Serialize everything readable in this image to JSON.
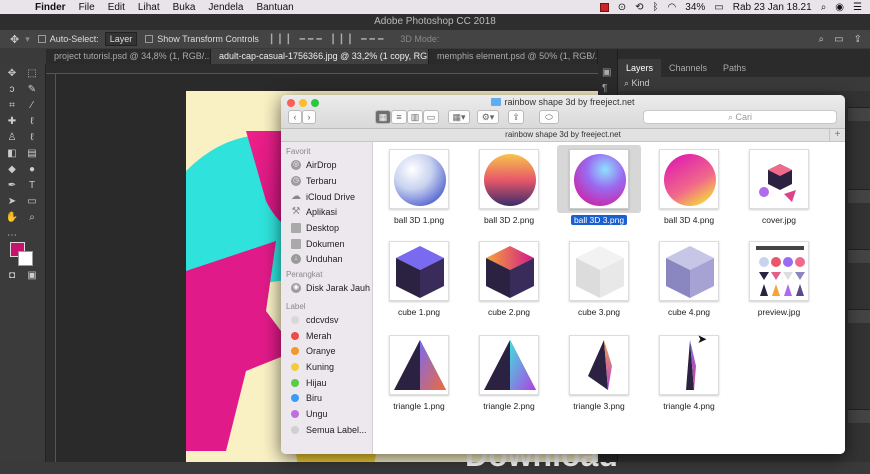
{
  "menubar": {
    "app": "Finder",
    "items": [
      "File",
      "Edit",
      "Lihat",
      "Buka",
      "Jendela",
      "Bantuan"
    ],
    "battery": "34%",
    "datetime": "Rab 23 Jan  18.21"
  },
  "photoshop": {
    "title": "Adobe Photoshop CC 2018",
    "auto_select_label": "Auto-Select:",
    "auto_select_value": "Layer",
    "transform_label": "Show Transform Controls",
    "mode_3d": "3D Mode:",
    "doc_tabs": [
      "project tutorisl.psd @ 34,8% (1, RGB/...",
      "adult-cap-casual-1756366.jpg @ 33,2% (1 copy, RGB/8) *",
      "memphis element.psd @ 50% (1, RGB/..."
    ],
    "canvas_text": "Download"
  },
  "layers_panel": {
    "tabs": [
      "Layers",
      "Channels",
      "Paths"
    ],
    "kind_label": "Kind"
  },
  "finder": {
    "title": "rainbow shape 3d by freeject.net",
    "path_title": "rainbow shape 3d by freeject.net",
    "search_placeholder": "Cari",
    "sidebar": {
      "favorites_header": "Favorit",
      "favorites": [
        "AirDrop",
        "Terbaru",
        "iCloud Drive",
        "Aplikasi",
        "Desktop",
        "Dokumen",
        "Unduhan"
      ],
      "devices_header": "Perangkat",
      "devices": [
        "Disk Jarak Jauh"
      ],
      "labels_header": "Label",
      "labels": [
        {
          "name": "cdcvdsv",
          "color": "#d8d8d8"
        },
        {
          "name": "Merah",
          "color": "#ee4b47"
        },
        {
          "name": "Oranye",
          "color": "#f5982b"
        },
        {
          "name": "Kuning",
          "color": "#f5cb3a"
        },
        {
          "name": "Hijau",
          "color": "#5cca47"
        },
        {
          "name": "Biru",
          "color": "#3b9cf5"
        },
        {
          "name": "Ungu",
          "color": "#bd6fe0"
        },
        {
          "name": "Semua Label...",
          "color": "#d0d0d0"
        }
      ]
    },
    "files": [
      "ball 3D 1.png",
      "ball 3D 2.png",
      "ball 3D 3.png",
      "ball 3D 4.png",
      "cover.jpg",
      "cube 1.png",
      "cube 2.png",
      "cube 3.png",
      "cube 4.png",
      "preview.jpg",
      "triangle 1.png",
      "triangle 2.png",
      "triangle 3.png",
      "triangle 4.png"
    ],
    "selected_file": "ball 3D 3.png"
  }
}
